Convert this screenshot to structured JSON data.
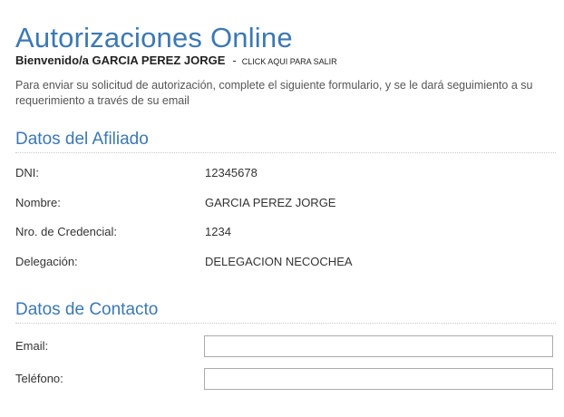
{
  "header": {
    "title": "Autorizaciones Online"
  },
  "welcome": {
    "greeting": "Bienvenido/a GARCIA PEREZ JORGE",
    "separator": "-",
    "exit_link": "CLICK AQUI PARA SALIR"
  },
  "intro": "Para enviar su solicitud de autorización, complete el siguiente formulario, y se le dará seguimiento a su requerimiento a través de su email",
  "affiliate": {
    "section_title": "Datos del Afiliado",
    "rows": [
      {
        "label": "DNI:",
        "value": "12345678"
      },
      {
        "label": "Nombre:",
        "value": "GARCIA PEREZ JORGE"
      },
      {
        "label": "Nro. de Credencial:",
        "value": "1234"
      },
      {
        "label": "Delegación:",
        "value": "DELEGACION NECOCHEA"
      }
    ]
  },
  "contact": {
    "section_title": "Datos de Contacto",
    "email_label": "Email:",
    "email_value": "",
    "phone_label": "Teléfono:",
    "phone_value": ""
  },
  "colors": {
    "accent": "#3c78b4",
    "text": "#333333"
  }
}
